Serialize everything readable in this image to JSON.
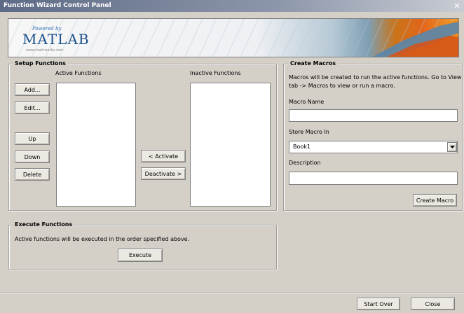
{
  "window": {
    "title": "Function Wizard Control Panel",
    "close_glyph": "✕"
  },
  "banner": {
    "powered_by": "Powered by",
    "logo": "MATLAB",
    "url": "www.mathworks.com"
  },
  "setup": {
    "title": "Setup Functions",
    "active_label": "Active Functions",
    "inactive_label": "Inactive Functions",
    "buttons": {
      "add": "Add...",
      "edit": "Edit...",
      "up": "Up",
      "down": "Down",
      "delete": "Delete",
      "activate": "< Activate",
      "deactivate": "Deactivate >"
    }
  },
  "macros": {
    "title": "Create Macros",
    "description_text_1": "Macros will be created to run the active functions. Go to View",
    "description_text_2": "tab -> Macros to view or run a macro.",
    "name_label": "Macro Name",
    "name_value": "",
    "store_label": "Store Macro In",
    "store_value": "Book1",
    "desc_label": "Description",
    "desc_value": "",
    "create_button": "Create Macro"
  },
  "execute": {
    "title": "Execute Functions",
    "info": "Active functions will be executed in the order specified above.",
    "button": "Execute"
  },
  "footer": {
    "start_over": "Start Over",
    "close": "Close"
  },
  "icons": {
    "dropdown": "chevron-down-icon",
    "close": "close-icon"
  },
  "colors": {
    "window_bg": "#d4d0c8",
    "titlebar": "#5e6b86",
    "logo_blue": "#1a4f8b",
    "accent_orange": "#e2651b"
  }
}
